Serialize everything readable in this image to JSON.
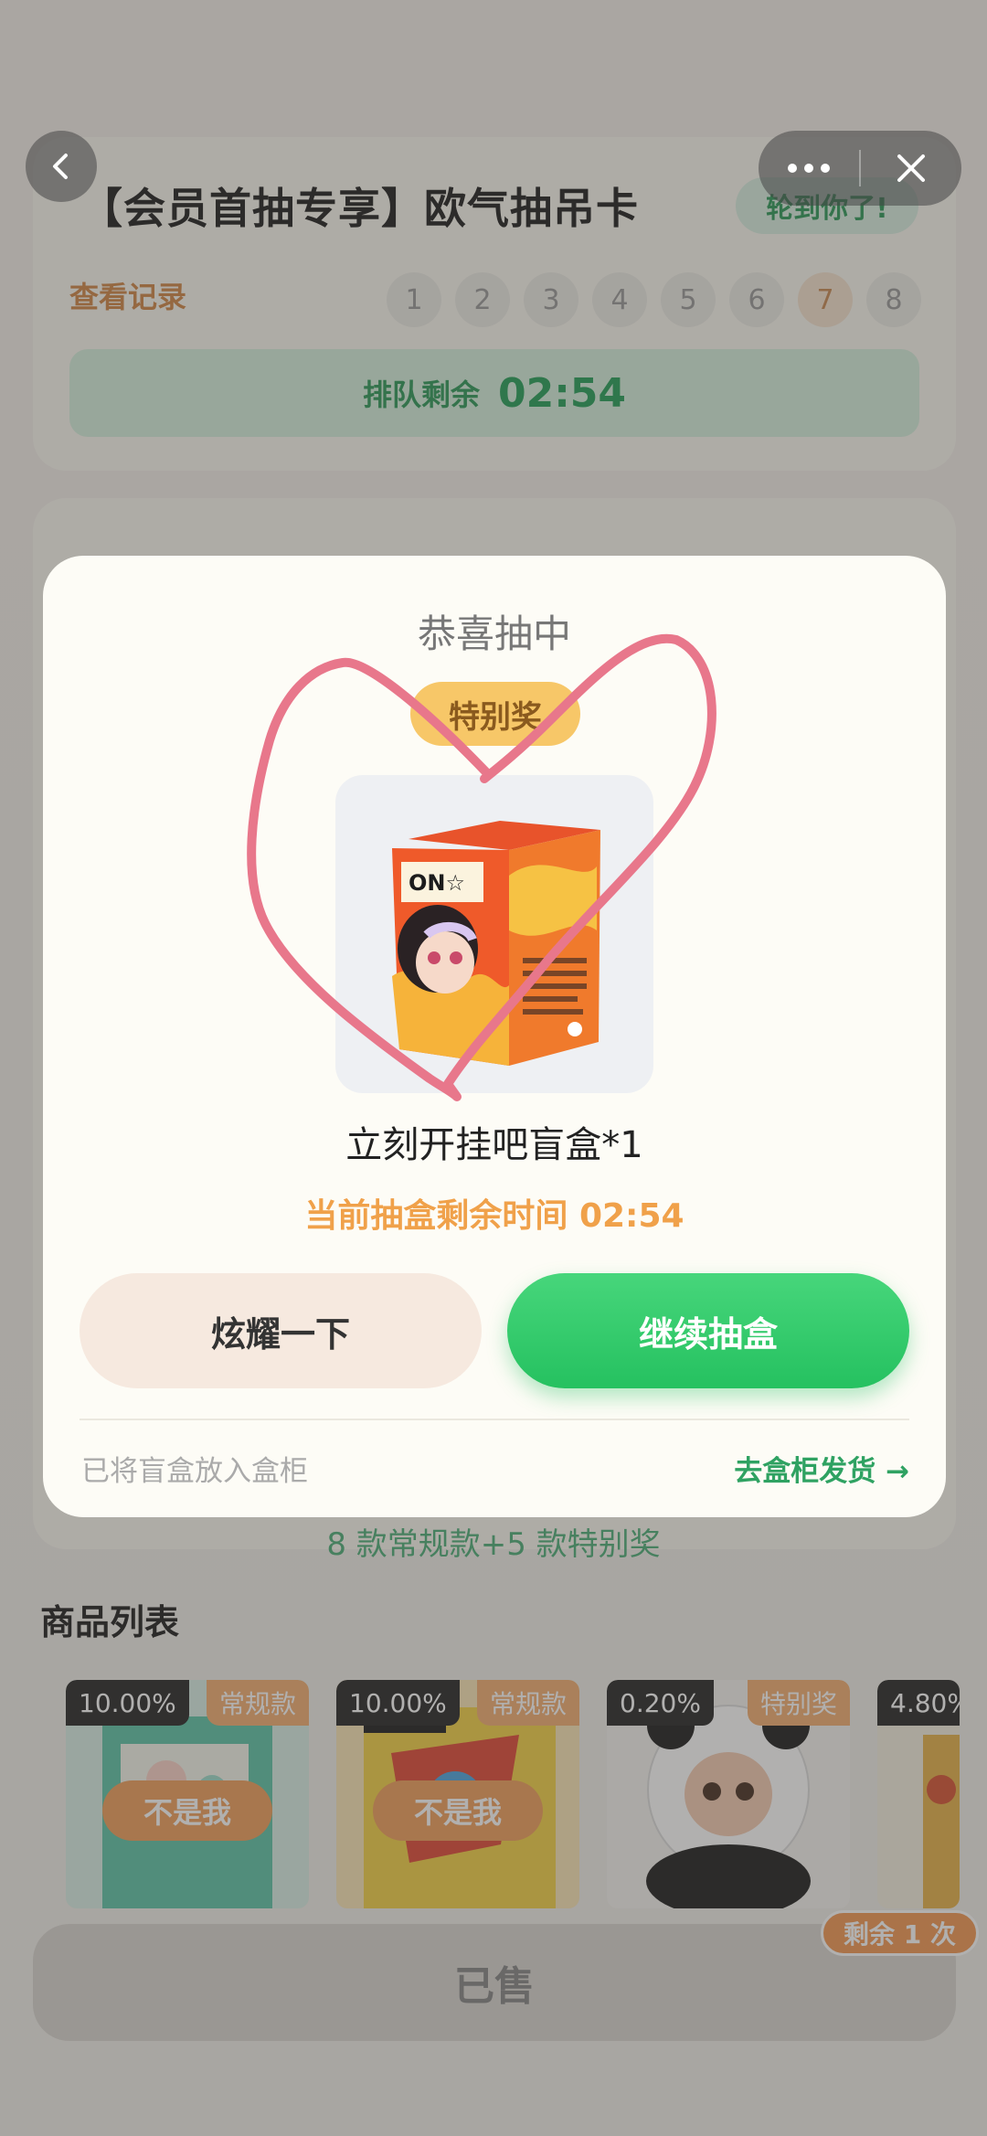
{
  "header": {
    "title": "【会员首抽专享】欧气抽吊卡",
    "turn_badge": "轮到你了!",
    "record_link": "查看记录",
    "queue_numbers": [
      "1",
      "2",
      "3",
      "4",
      "5",
      "6",
      "7",
      "8"
    ],
    "queue_label": "排队剩余",
    "queue_time": "02:54"
  },
  "nav": {
    "back_icon": "chevron-left-icon",
    "more_icon": "more-dots-icon",
    "close_icon": "close-icon"
  },
  "modal": {
    "title": "恭喜抽中",
    "badge": "特别奖",
    "prize_name": "立刻开挂吧盲盒*1",
    "remaining_time": "当前抽盒剩余时间 02:54",
    "btn_show": "炫耀一下",
    "btn_continue": "继续抽盒",
    "note": "已将盲盒放入盒柜",
    "link": "去盒柜发货 →"
  },
  "content": {
    "styles_note": "8 款常规款+5 款特别奖",
    "list_title": "商品列表",
    "products": [
      {
        "pct": "10.00%",
        "tag": "常规款",
        "action": "不是我"
      },
      {
        "pct": "10.00%",
        "tag": "常规款",
        "action": "不是我"
      },
      {
        "pct": "0.20%",
        "tag": "特别奖"
      },
      {
        "pct": "4.80%"
      }
    ],
    "sold_button": "已售",
    "remain_badge": "剩余 1 次"
  },
  "colors": {
    "accent_green": "#25c160",
    "accent_orange": "#f0a14a",
    "doodle": "#e8778b"
  }
}
